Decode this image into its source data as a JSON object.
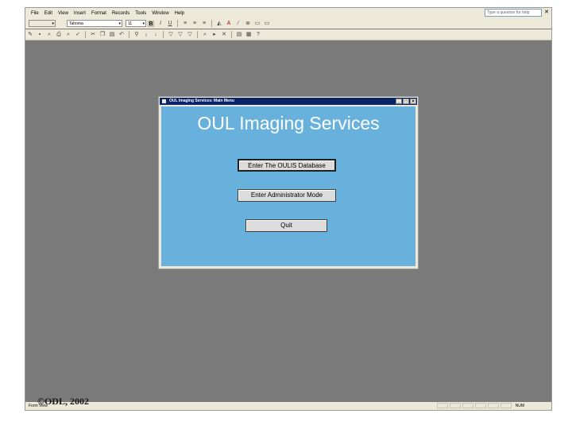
{
  "menu": [
    "File",
    "Edit",
    "View",
    "Insert",
    "Format",
    "Records",
    "Tools",
    "Window",
    "Help"
  ],
  "help_box": "Type a question for help",
  "doc_close": "✕",
  "toolbar1": {
    "object_box": "",
    "font_name": "Tahoma",
    "font_size": "11"
  },
  "dialog": {
    "title": "OUL Imaging Services: Main Menu",
    "heading": "OUL Imaging Services",
    "buttons": [
      "Enter The OULIS Database",
      "Enter Administrator Mode",
      "Quit"
    ],
    "controls": [
      "_",
      "□",
      "✕"
    ]
  },
  "statusbar": {
    "left": "Form View",
    "right": "NUM"
  },
  "watermark": "©ODL, 2002"
}
